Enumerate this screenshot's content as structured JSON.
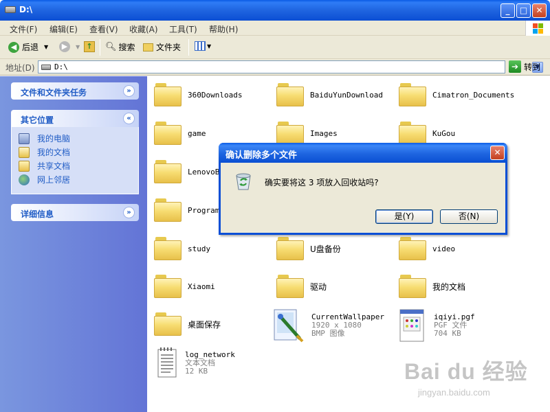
{
  "window": {
    "title": "D:\\"
  },
  "menu": [
    "文件(F)",
    "编辑(E)",
    "查看(V)",
    "收藏(A)",
    "工具(T)",
    "帮助(H)"
  ],
  "toolbar": {
    "back": "后退",
    "search": "搜索",
    "folders": "文件夹"
  },
  "address": {
    "label": "地址(D)",
    "value": "D:\\",
    "go": "转到"
  },
  "tasks": {
    "file_tasks": "文件和文件夹任务",
    "other_places": "其它位置",
    "places": [
      "我的电脑",
      "我的文档",
      "共享文档",
      "网上邻居"
    ],
    "details": "详细信息"
  },
  "files": [
    {
      "name": "360Downloads"
    },
    {
      "name": "BaiduYunDownload"
    },
    {
      "name": "Cimatron_Documents"
    },
    {
      "name": "game"
    },
    {
      "name": "Images"
    },
    {
      "name": "KuGou"
    },
    {
      "name": "LenovoBa"
    },
    {
      "name": "Program"
    },
    {
      "name": "study"
    },
    {
      "name": "U盘备份"
    },
    {
      "name": "video"
    },
    {
      "name": "Xiaomi"
    },
    {
      "name": "驱动"
    },
    {
      "name": "我的文档"
    },
    {
      "name": "桌面保存"
    },
    {
      "name": "CurrentWallpaper",
      "line2": "1920 x 1080",
      "line3": "BMP 图像"
    },
    {
      "name": "iqiyi.pgf",
      "line2": "PGF 文件",
      "line3": "704 KB"
    },
    {
      "name": "log_network",
      "line2": "文本文档",
      "line3": "12 KB"
    }
  ],
  "dialog": {
    "title": "确认删除多个文件",
    "message": "确实要将这 3 项放入回收站吗?",
    "yes": "是(Y)",
    "no": "否(N)"
  },
  "watermark": {
    "logo": "Bai du 经验",
    "url": "jingyan.baidu.com"
  },
  "colors": {
    "title_blue": "#0a5be5",
    "task_pane": "#6f85dc",
    "task_text": "#215dc6",
    "folder_yellow": "#f7dd72"
  }
}
